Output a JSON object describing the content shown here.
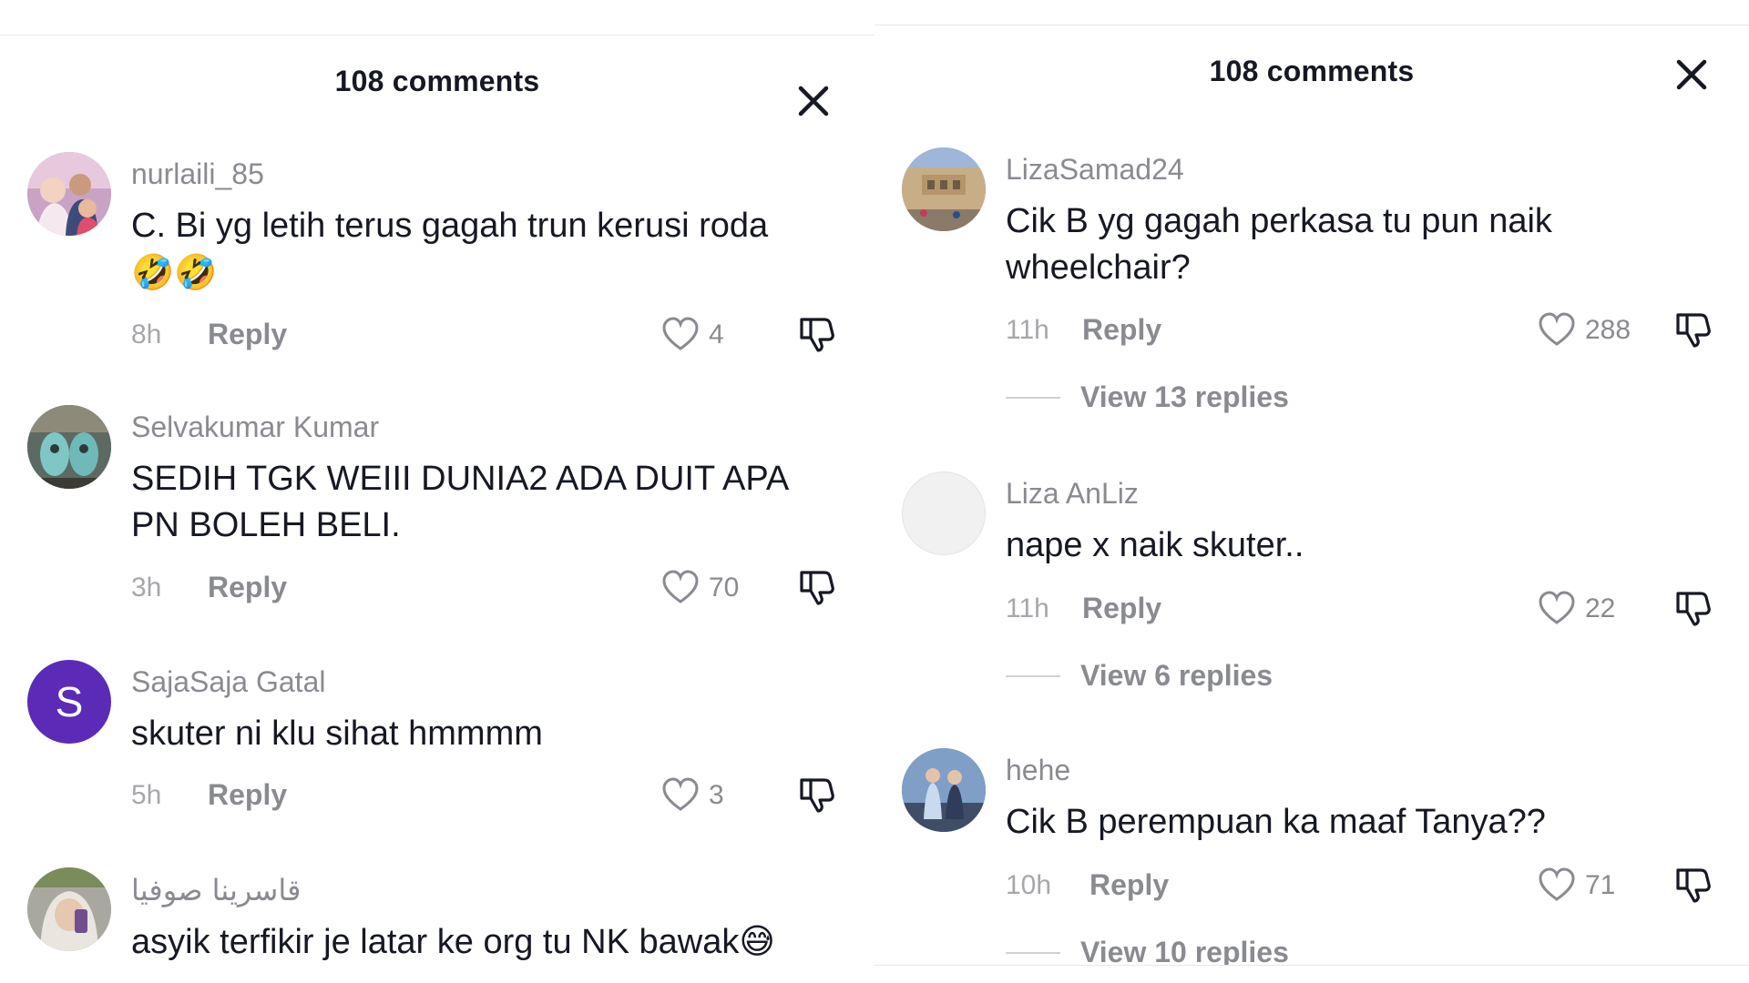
{
  "left_panel": {
    "title": "108 comments",
    "comments": [
      {
        "username": "nurlaili_85",
        "text": "C. Bi yg letih terus gagah trun kerusi roda",
        "emoji_line": "🤣🤣",
        "time": "8h",
        "reply": "Reply",
        "likes": "4"
      },
      {
        "username": "Selvakumar Kumar",
        "text": "SEDIH TGK WEIII DUNIA2 ADA DUIT APA PN BOLEH BELI.",
        "time": "3h",
        "reply": "Reply",
        "likes": "70"
      },
      {
        "username": "SajaSaja Gatal",
        "avatar_letter": "S",
        "text": "skuter ni klu sihat hmmmm",
        "time": "5h",
        "reply": "Reply",
        "likes": "3"
      },
      {
        "username": "قاسرينا صوفيا",
        "text": "asyik terfikir je latar ke org tu NK bawak",
        "emoji_end": "😅"
      }
    ]
  },
  "right_panel": {
    "title": "108 comments",
    "comments": [
      {
        "username": "LizaSamad24",
        "text": "Cik B yg gagah perkasa tu pun naik wheelchair?",
        "time": "11h",
        "reply": "Reply",
        "likes": "288",
        "view_replies": "View 13 replies"
      },
      {
        "username": "Liza AnLiz",
        "text": "nape x naik skuter..",
        "time": "11h",
        "reply": "Reply",
        "likes": "22",
        "view_replies": "View 6 replies"
      },
      {
        "username": "hehe",
        "text": "Cik B perempuan ka maaf Tanya??",
        "time": "10h",
        "reply": "Reply",
        "likes": "71",
        "view_replies": "View 10 replies"
      }
    ]
  },
  "colors": {
    "primary_text": "#161823",
    "secondary_text": "#8a8b91",
    "time_text": "#a6a7ab",
    "avatar_purple": "#5b2bb8"
  },
  "icons": {
    "close": "close-icon",
    "like": "heart-outline-icon",
    "dislike": "thumbs-down-icon"
  }
}
